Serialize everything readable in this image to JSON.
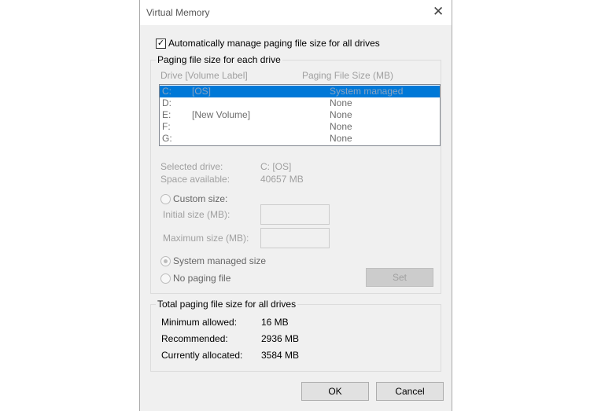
{
  "title": "Virtual Memory",
  "auto_manage": {
    "label": "Automatically manage paging file size for all drives",
    "checked": true
  },
  "per_drive": {
    "group_label": "Paging file size for each drive",
    "col_drive": "Drive  [Volume Label]",
    "col_size": "Paging File Size (MB)",
    "drives": [
      {
        "drive": "C:",
        "label": "[OS]",
        "size": "System managed"
      },
      {
        "drive": "D:",
        "label": "",
        "size": "None"
      },
      {
        "drive": "E:",
        "label": "[New Volume]",
        "size": "None"
      },
      {
        "drive": "F:",
        "label": "",
        "size": "None"
      },
      {
        "drive": "G:",
        "label": "",
        "size": "None"
      }
    ],
    "selected_drive_label": "Selected drive:",
    "selected_drive_value": "C:  [OS]",
    "space_label": "Space available:",
    "space_value": "40657 MB",
    "custom_size": "Custom size:",
    "initial_size": "Initial size (MB):",
    "maximum_size": "Maximum size (MB):",
    "initial_value": "",
    "maximum_value": "",
    "system_managed": "System managed size",
    "no_paging": "No paging file",
    "set": "Set"
  },
  "total": {
    "group_label": "Total paging file size for all drives",
    "min_label": "Minimum allowed:",
    "min_value": "16 MB",
    "rec_label": "Recommended:",
    "rec_value": "2936 MB",
    "cur_label": "Currently allocated:",
    "cur_value": "3584 MB"
  },
  "ok": "OK",
  "cancel": "Cancel"
}
